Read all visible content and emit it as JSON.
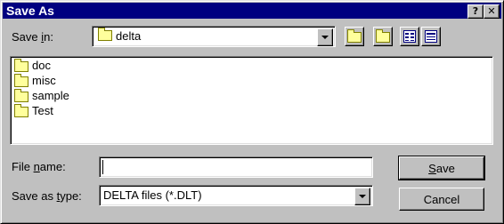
{
  "window": {
    "title": "Save As",
    "help_icon": "?",
    "close_icon": "✕"
  },
  "save_in": {
    "label_pre": "Save ",
    "label_u": "i",
    "label_post": "n:",
    "value": "delta"
  },
  "toolbar": {
    "icons": [
      "up-one-level-icon",
      "create-new-folder-icon",
      "list-view-icon",
      "details-view-icon"
    ]
  },
  "files": [
    {
      "name": "doc",
      "icon": "folder-icon"
    },
    {
      "name": "misc",
      "icon": "folder-icon"
    },
    {
      "name": "sample",
      "icon": "folder-icon"
    },
    {
      "name": "Test",
      "icon": "folder-icon"
    }
  ],
  "file_name": {
    "label_pre": "File ",
    "label_u": "n",
    "label_post": "ame:",
    "value": ""
  },
  "save_type": {
    "label_pre": "Save as ",
    "label_u": "t",
    "label_post": "ype:",
    "value": "DELTA files (*.DLT)"
  },
  "buttons": {
    "save_u": "S",
    "save_rest": "ave",
    "cancel": "Cancel"
  }
}
